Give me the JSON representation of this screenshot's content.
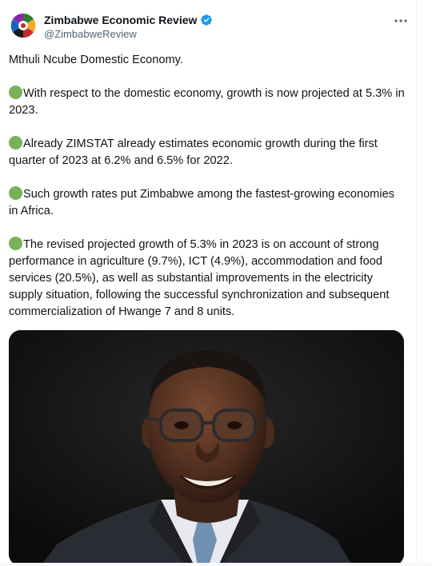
{
  "author": {
    "display_name": "Zimbabwe Economic Review",
    "handle": "@ZimbabweReview",
    "verified": true,
    "verified_color": "#1d9bf0",
    "avatar_icon": "economic-review-logo-icon"
  },
  "menu": {
    "icon": "more-options-icon"
  },
  "tweet": {
    "intro": "Mthuli Ncube Domestic Economy.",
    "bullet_icon": "green-circle-emoji",
    "bullets": [
      "With respect to the domestic economy, growth is now projected at 5.3% in 2023.",
      "Already ZIMSTAT already estimates economic growth during the first quarter of 2023 at  6.2% and 6.5% for 2022.",
      "Such growth rates put Zimbabwe among the fastest-growing economies in Africa.",
      "The revised projected growth of 5.3% in 2023 is on account of strong performance in agriculture (9.7%), ICT (4.9%), accommodation and food services (20.5%), as well as substantial improvements in the electricity supply situation, following the successful synchronization and subsequent commercialization of Hwange 7 and  8 units."
    ]
  },
  "media": {
    "type": "photo"
  },
  "colors": {
    "text_primary": "#0f1419",
    "text_secondary": "#536471",
    "bullet_green": "#78b159",
    "photo_background": "#111111"
  }
}
